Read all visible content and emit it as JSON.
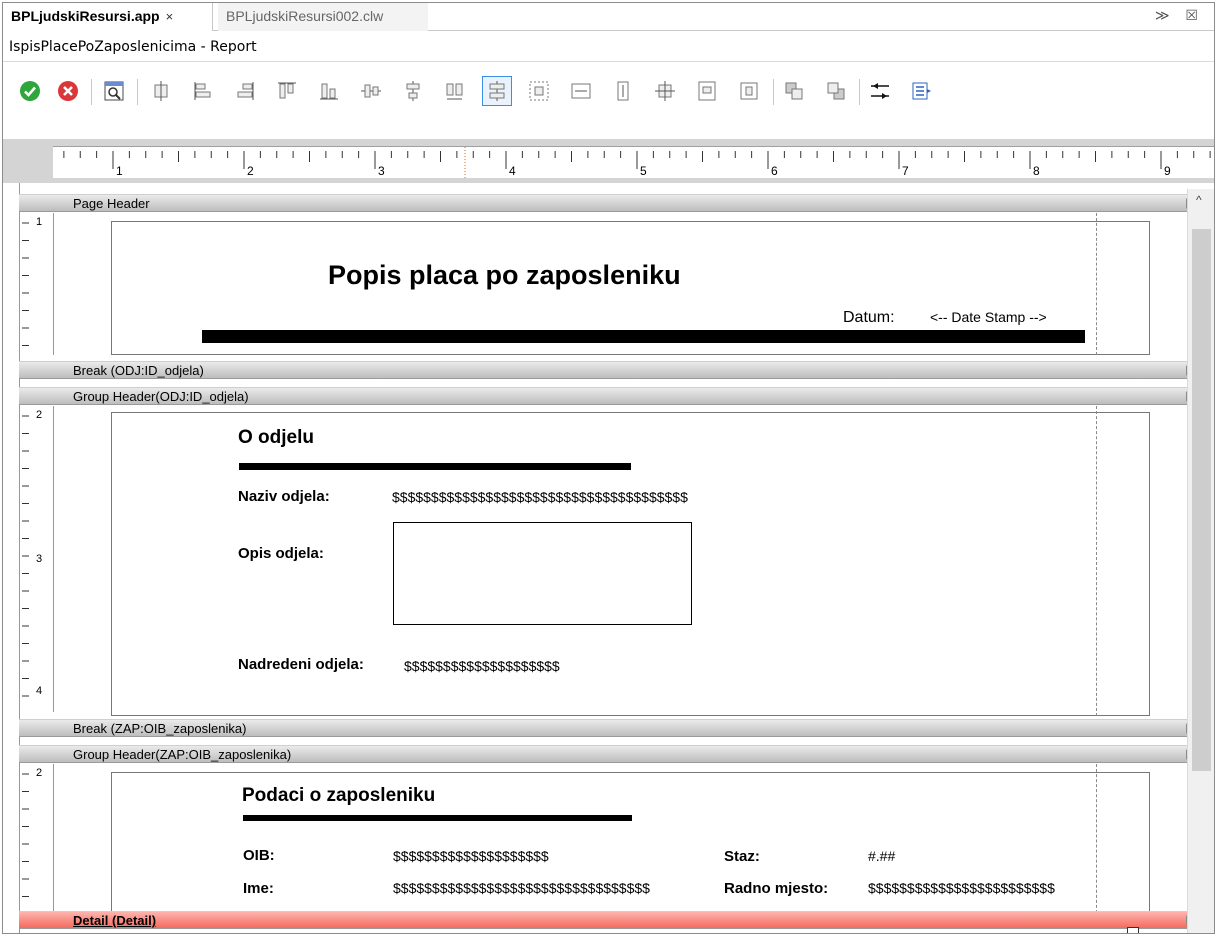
{
  "tabs": [
    {
      "label": "BPLjudskiResursi.app",
      "close": "×"
    },
    {
      "label": "BPLjudskiResursi002.clw"
    }
  ],
  "tab_controls": "≫ ☒",
  "window_title": "IspisPlacePoZaposlenicima - Report",
  "toolbar": {
    "icons": [
      "ok-icon",
      "cancel-icon",
      "preview-icon",
      "align-center-h-icon",
      "align-left-icon",
      "align-right-icon",
      "align-top-icon",
      "align-bottom-icon",
      "center-vertical-icon",
      "center-horizontal-icon",
      "same-width-icon",
      "same-height-icon",
      "space-h-icon",
      "space-v-icon",
      "resize-icon",
      "center-dialog-icon",
      "center-section-h-icon",
      "center-section-v-icon",
      "bring-front-icon",
      "send-back-icon",
      "tab-order-icon",
      "populate-icon"
    ]
  },
  "ruler": {
    "numbers": [
      "1",
      "2",
      "3",
      "4",
      "5",
      "6",
      "7",
      "8",
      "9"
    ]
  },
  "bands": {
    "page_header": "Page Header",
    "break_odj": "Break (ODJ:ID_odjela)",
    "group_header_odj": "Group Header(ODJ:ID_odjela)",
    "break_zap": "Break (ZAP:OIB_zaposlenika)",
    "group_header_zap": "Group Header(ZAP:OIB_zaposlenika)",
    "detail": "Detail (Detail)"
  },
  "vruler": {
    "n1": "1",
    "n2": "2",
    "n3": "3",
    "n4": "4",
    "n2b": "2"
  },
  "page_header": {
    "title": "Popis placa po zaposleniku",
    "datum_label": "Datum:",
    "date_stamp": "<-- Date Stamp -->"
  },
  "odjel": {
    "heading": "O odjelu",
    "naziv_label": "Naziv odjela:",
    "naziv_value": "$$$$$$$$$$$$$$$$$$$$$$$$$$$$$$$$$$$$$$",
    "opis_label": "Opis odjela:",
    "nadredeni_label": "Nadredeni odjela:",
    "nadredeni_value": "$$$$$$$$$$$$$$$$$$$$"
  },
  "zaposlenik": {
    "heading": "Podaci o zaposleniku",
    "oib_label": "OIB:",
    "oib_value": "$$$$$$$$$$$$$$$$$$$$",
    "staz_label": "Staz:",
    "staz_value": "#.##",
    "ime_label": "Ime:",
    "ime_value": "$$$$$$$$$$$$$$$$$$$$$$$$$$$$$$$$$",
    "radno_label": "Radno mjesto:",
    "radno_value": "$$$$$$$$$$$$$$$$$$$$$$$$"
  },
  "scrollbar": {
    "up": "^"
  },
  "colors": {
    "accent": "#3a8ee6",
    "detail_band": "#f46b60",
    "ok": "#2ea63b",
    "cancel": "#d9373a"
  }
}
